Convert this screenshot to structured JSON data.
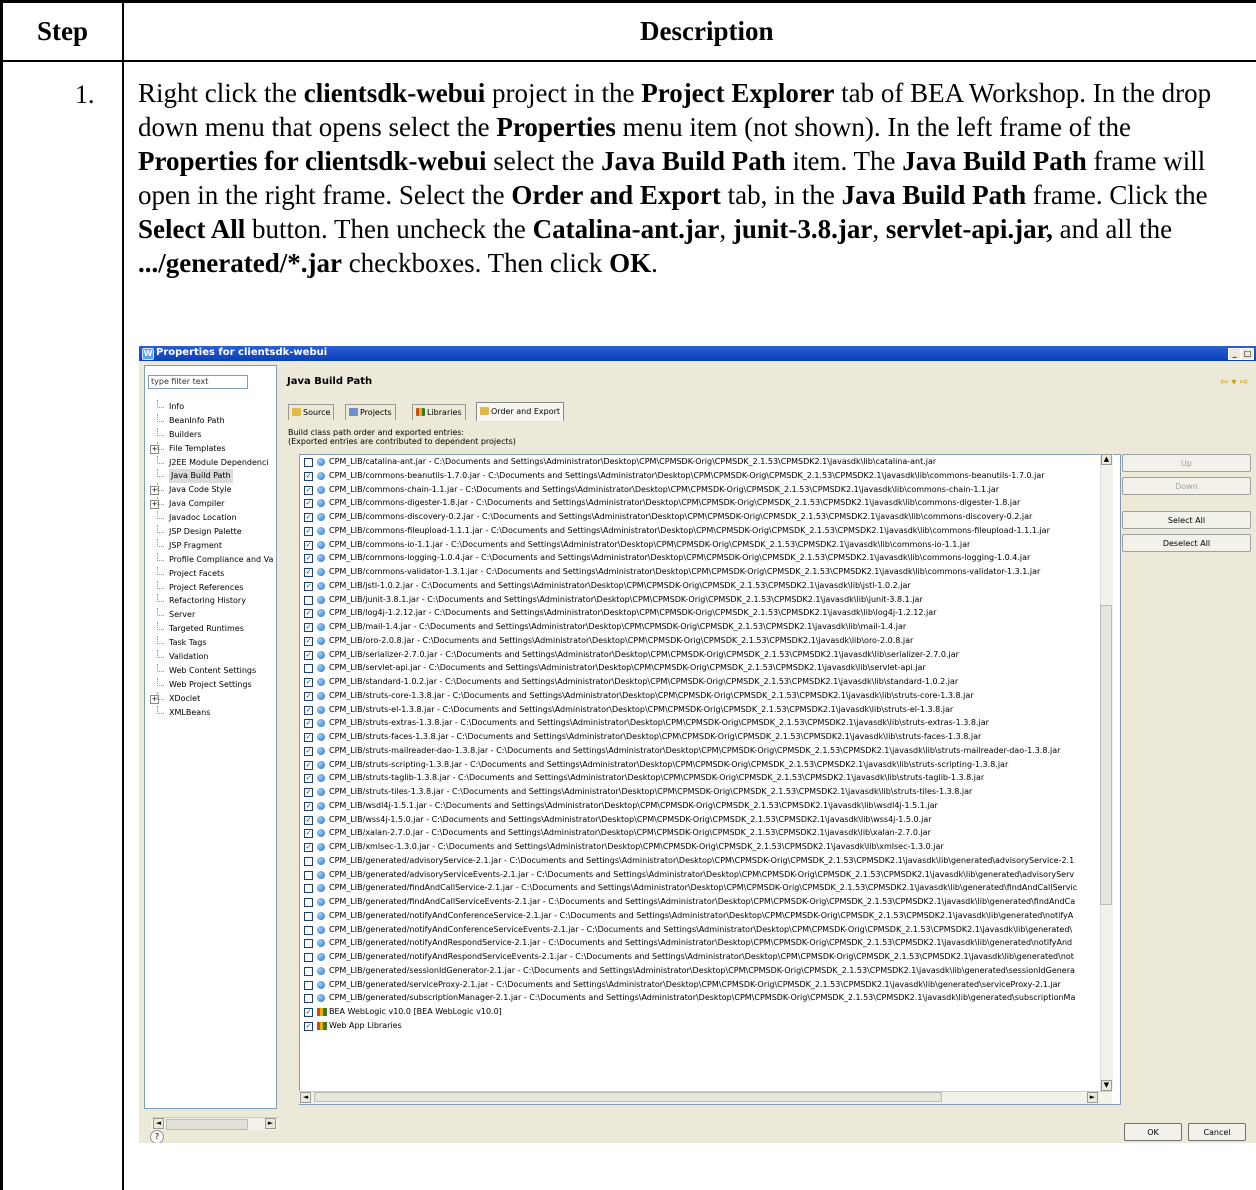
{
  "table": {
    "header_step": "Step",
    "header_description": "Description",
    "step_number": "1.",
    "instruction": [
      {
        "t": "Right click the ",
        "b": false
      },
      {
        "t": "clientsdk-webui",
        "b": true
      },
      {
        "t": " project in the ",
        "b": false
      },
      {
        "t": "Project Explorer",
        "b": true
      },
      {
        "t": " tab of BEA Workshop. In the drop down menu that opens select the ",
        "b": false
      },
      {
        "t": "Properties",
        "b": true
      },
      {
        "t": " menu item (not shown). In the left frame of the ",
        "b": false
      },
      {
        "t": "Properties for clientsdk-webui",
        "b": true
      },
      {
        "t": " select the ",
        "b": false
      },
      {
        "t": "Java Build Path",
        "b": true
      },
      {
        "t": " item. The ",
        "b": false
      },
      {
        "t": "Java Build Path",
        "b": true
      },
      {
        "t": " frame will open in the right frame. Select the ",
        "b": false
      },
      {
        "t": "Order and Export",
        "b": true
      },
      {
        "t": " tab, in the ",
        "b": false
      },
      {
        "t": "Java Build Path",
        "b": true
      },
      {
        "t": " frame. Click the ",
        "b": false
      },
      {
        "t": "Select All",
        "b": true
      },
      {
        "t": " button. Then uncheck the ",
        "b": false
      },
      {
        "t": "Catalina-ant.jar",
        "b": true
      },
      {
        "t": ", ",
        "b": false
      },
      {
        "t": "junit-3.8.jar",
        "b": true
      },
      {
        "t": ", ",
        "b": false
      },
      {
        "t": "servlet-api.jar,",
        "b": true
      },
      {
        "t": " and all the ",
        "b": false
      },
      {
        "t": ".../generated/*.jar",
        "b": true
      },
      {
        "t": " checkboxes. Then click ",
        "b": false
      },
      {
        "t": "OK",
        "b": true
      },
      {
        "t": ".",
        "b": false
      }
    ]
  },
  "dialog": {
    "title": "Properties for clientsdk-webui",
    "filter_placeholder": "type filter text",
    "tree": [
      {
        "label": "Info",
        "exp": false,
        "sel": false
      },
      {
        "label": "BeanInfo Path",
        "exp": false,
        "sel": false
      },
      {
        "label": "Builders",
        "exp": false,
        "sel": false
      },
      {
        "label": "File Templates",
        "exp": true,
        "sel": false
      },
      {
        "label": "J2EE Module Dependenci",
        "exp": false,
        "sel": false
      },
      {
        "label": "Java Build Path",
        "exp": false,
        "sel": true
      },
      {
        "label": "Java Code Style",
        "exp": true,
        "sel": false
      },
      {
        "label": "Java Compiler",
        "exp": true,
        "sel": false
      },
      {
        "label": "Javadoc Location",
        "exp": false,
        "sel": false
      },
      {
        "label": "JSP Design Palette",
        "exp": false,
        "sel": false
      },
      {
        "label": "JSP Fragment",
        "exp": false,
        "sel": false
      },
      {
        "label": "Profile Compliance and Va",
        "exp": false,
        "sel": false
      },
      {
        "label": "Project Facets",
        "exp": false,
        "sel": false
      },
      {
        "label": "Project References",
        "exp": false,
        "sel": false
      },
      {
        "label": "Refactoring History",
        "exp": false,
        "sel": false
      },
      {
        "label": "Server",
        "exp": false,
        "sel": false
      },
      {
        "label": "Targeted Runtimes",
        "exp": false,
        "sel": false
      },
      {
        "label": "Task Tags",
        "exp": false,
        "sel": false
      },
      {
        "label": "Validation",
        "exp": false,
        "sel": false
      },
      {
        "label": "Web Content Settings",
        "exp": false,
        "sel": false
      },
      {
        "label": "Web Project Settings",
        "exp": false,
        "sel": false
      },
      {
        "label": "XDoclet",
        "exp": true,
        "sel": false
      },
      {
        "label": "XMLBeans",
        "exp": false,
        "sel": false
      }
    ],
    "page_title": "Java Build Path",
    "tabs": [
      "Source",
      "Projects",
      "Libraries",
      "Order and Export"
    ],
    "active_tab": "Order and Export",
    "desc_line1": "Build class path order and exported entries:",
    "desc_line2": "(Exported entries are contributed to dependent projects)",
    "entries": [
      {
        "text": "CPM_LIB/catalina-ant.jar - C:\\Documents and Settings\\Administrator\\Desktop\\CPM\\CPMSDK-Orig\\CPMSDK_2.1.53\\CPMSDK2.1\\javasdk\\lib\\catalina-ant.jar",
        "checked": false,
        "kind": "jar"
      },
      {
        "text": "CPM_LIB/commons-beanutils-1.7.0.jar - C:\\Documents and Settings\\Administrator\\Desktop\\CPM\\CPMSDK-Orig\\CPMSDK_2.1.53\\CPMSDK2.1\\javasdk\\lib\\commons-beanutils-1.7.0.jar",
        "checked": true,
        "kind": "jar"
      },
      {
        "text": "CPM_LIB/commons-chain-1.1.jar - C:\\Documents and Settings\\Administrator\\Desktop\\CPM\\CPMSDK-Orig\\CPMSDK_2.1.53\\CPMSDK2.1\\javasdk\\lib\\commons-chain-1.1.jar",
        "checked": true,
        "kind": "jar"
      },
      {
        "text": "CPM_LIB/commons-digester-1.8.jar - C:\\Documents and Settings\\Administrator\\Desktop\\CPM\\CPMSDK-Orig\\CPMSDK_2.1.53\\CPMSDK2.1\\javasdk\\lib\\commons-digester-1.8.jar",
        "checked": true,
        "kind": "jar"
      },
      {
        "text": "CPM_LIB/commons-discovery-0.2.jar - C:\\Documents and Settings\\Administrator\\Desktop\\CPM\\CPMSDK-Orig\\CPMSDK_2.1.53\\CPMSDK2.1\\javasdk\\lib\\commons-discovery-0.2.jar",
        "checked": true,
        "kind": "jar"
      },
      {
        "text": "CPM_LIB/commons-fileupload-1.1.1.jar - C:\\Documents and Settings\\Administrator\\Desktop\\CPM\\CPMSDK-Orig\\CPMSDK_2.1.53\\CPMSDK2.1\\javasdk\\lib\\commons-fileupload-1.1.1.jar",
        "checked": true,
        "kind": "jar"
      },
      {
        "text": "CPM_LIB/commons-io-1.1.jar - C:\\Documents and Settings\\Administrator\\Desktop\\CPM\\CPMSDK-Orig\\CPMSDK_2.1.53\\CPMSDK2.1\\javasdk\\lib\\commons-io-1.1.jar",
        "checked": true,
        "kind": "jar"
      },
      {
        "text": "CPM_LIB/commons-logging-1.0.4.jar - C:\\Documents and Settings\\Administrator\\Desktop\\CPM\\CPMSDK-Orig\\CPMSDK_2.1.53\\CPMSDK2.1\\javasdk\\lib\\commons-logging-1.0.4.jar",
        "checked": true,
        "kind": "jar"
      },
      {
        "text": "CPM_LIB/commons-validator-1.3.1.jar - C:\\Documents and Settings\\Administrator\\Desktop\\CPM\\CPMSDK-Orig\\CPMSDK_2.1.53\\CPMSDK2.1\\javasdk\\lib\\commons-validator-1.3.1.jar",
        "checked": true,
        "kind": "jar"
      },
      {
        "text": "CPM_LIB/jstl-1.0.2.jar - C:\\Documents and Settings\\Administrator\\Desktop\\CPM\\CPMSDK-Orig\\CPMSDK_2.1.53\\CPMSDK2.1\\javasdk\\lib\\jstl-1.0.2.jar",
        "checked": true,
        "kind": "jar"
      },
      {
        "text": "CPM_LIB/junit-3.8.1.jar - C:\\Documents and Settings\\Administrator\\Desktop\\CPM\\CPMSDK-Orig\\CPMSDK_2.1.53\\CPMSDK2.1\\javasdk\\lib\\junit-3.8.1.jar",
        "checked": false,
        "kind": "jar"
      },
      {
        "text": "CPM_LIB/log4j-1.2.12.jar - C:\\Documents and Settings\\Administrator\\Desktop\\CPM\\CPMSDK-Orig\\CPMSDK_2.1.53\\CPMSDK2.1\\javasdk\\lib\\log4j-1.2.12.jar",
        "checked": true,
        "kind": "jar"
      },
      {
        "text": "CPM_LIB/mail-1.4.jar - C:\\Documents and Settings\\Administrator\\Desktop\\CPM\\CPMSDK-Orig\\CPMSDK_2.1.53\\CPMSDK2.1\\javasdk\\lib\\mail-1.4.jar",
        "checked": true,
        "kind": "jar"
      },
      {
        "text": "CPM_LIB/oro-2.0.8.jar - C:\\Documents and Settings\\Administrator\\Desktop\\CPM\\CPMSDK-Orig\\CPMSDK_2.1.53\\CPMSDK2.1\\javasdk\\lib\\oro-2.0.8.jar",
        "checked": true,
        "kind": "jar"
      },
      {
        "text": "CPM_LIB/serializer-2.7.0.jar - C:\\Documents and Settings\\Administrator\\Desktop\\CPM\\CPMSDK-Orig\\CPMSDK_2.1.53\\CPMSDK2.1\\javasdk\\lib\\serializer-2.7.0.jar",
        "checked": true,
        "kind": "jar"
      },
      {
        "text": "CPM_LIB/servlet-api.jar - C:\\Documents and Settings\\Administrator\\Desktop\\CPM\\CPMSDK-Orig\\CPMSDK_2.1.53\\CPMSDK2.1\\javasdk\\lib\\servlet-api.jar",
        "checked": false,
        "kind": "jar"
      },
      {
        "text": "CPM_LIB/standard-1.0.2.jar - C:\\Documents and Settings\\Administrator\\Desktop\\CPM\\CPMSDK-Orig\\CPMSDK_2.1.53\\CPMSDK2.1\\javasdk\\lib\\standard-1.0.2.jar",
        "checked": true,
        "kind": "jar"
      },
      {
        "text": "CPM_LIB/struts-core-1.3.8.jar - C:\\Documents and Settings\\Administrator\\Desktop\\CPM\\CPMSDK-Orig\\CPMSDK_2.1.53\\CPMSDK2.1\\javasdk\\lib\\struts-core-1.3.8.jar",
        "checked": true,
        "kind": "jar"
      },
      {
        "text": "CPM_LIB/struts-el-1.3.8.jar - C:\\Documents and Settings\\Administrator\\Desktop\\CPM\\CPMSDK-Orig\\CPMSDK_2.1.53\\CPMSDK2.1\\javasdk\\lib\\struts-el-1.3.8.jar",
        "checked": true,
        "kind": "jar"
      },
      {
        "text": "CPM_LIB/struts-extras-1.3.8.jar - C:\\Documents and Settings\\Administrator\\Desktop\\CPM\\CPMSDK-Orig\\CPMSDK_2.1.53\\CPMSDK2.1\\javasdk\\lib\\struts-extras-1.3.8.jar",
        "checked": true,
        "kind": "jar"
      },
      {
        "text": "CPM_LIB/struts-faces-1.3.8.jar - C:\\Documents and Settings\\Administrator\\Desktop\\CPM\\CPMSDK-Orig\\CPMSDK_2.1.53\\CPMSDK2.1\\javasdk\\lib\\struts-faces-1.3.8.jar",
        "checked": true,
        "kind": "jar"
      },
      {
        "text": "CPM_LIB/struts-mailreader-dao-1.3.8.jar - C:\\Documents and Settings\\Administrator\\Desktop\\CPM\\CPMSDK-Orig\\CPMSDK_2.1.53\\CPMSDK2.1\\javasdk\\lib\\struts-mailreader-dao-1.3.8.jar",
        "checked": true,
        "kind": "jar"
      },
      {
        "text": "CPM_LIB/struts-scripting-1.3.8.jar - C:\\Documents and Settings\\Administrator\\Desktop\\CPM\\CPMSDK-Orig\\CPMSDK_2.1.53\\CPMSDK2.1\\javasdk\\lib\\struts-scripting-1.3.8.jar",
        "checked": true,
        "kind": "jar"
      },
      {
        "text": "CPM_LIB/struts-taglib-1.3.8.jar - C:\\Documents and Settings\\Administrator\\Desktop\\CPM\\CPMSDK-Orig\\CPMSDK_2.1.53\\CPMSDK2.1\\javasdk\\lib\\struts-taglib-1.3.8.jar",
        "checked": true,
        "kind": "jar"
      },
      {
        "text": "CPM_LIB/struts-tiles-1.3.8.jar - C:\\Documents and Settings\\Administrator\\Desktop\\CPM\\CPMSDK-Orig\\CPMSDK_2.1.53\\CPMSDK2.1\\javasdk\\lib\\struts-tiles-1.3.8.jar",
        "checked": true,
        "kind": "jar"
      },
      {
        "text": "CPM_LIB/wsdl4j-1.5.1.jar - C:\\Documents and Settings\\Administrator\\Desktop\\CPM\\CPMSDK-Orig\\CPMSDK_2.1.53\\CPMSDK2.1\\javasdk\\lib\\wsdl4j-1.5.1.jar",
        "checked": true,
        "kind": "jar"
      },
      {
        "text": "CPM_LIB/wss4j-1.5.0.jar - C:\\Documents and Settings\\Administrator\\Desktop\\CPM\\CPMSDK-Orig\\CPMSDK_2.1.53\\CPMSDK2.1\\javasdk\\lib\\wss4j-1.5.0.jar",
        "checked": true,
        "kind": "jar"
      },
      {
        "text": "CPM_LIB/xalan-2.7.0.jar - C:\\Documents and Settings\\Administrator\\Desktop\\CPM\\CPMSDK-Orig\\CPMSDK_2.1.53\\CPMSDK2.1\\javasdk\\lib\\xalan-2.7.0.jar",
        "checked": true,
        "kind": "jar"
      },
      {
        "text": "CPM_LIB/xmlsec-1.3.0.jar - C:\\Documents and Settings\\Administrator\\Desktop\\CPM\\CPMSDK-Orig\\CPMSDK_2.1.53\\CPMSDK2.1\\javasdk\\lib\\xmlsec-1.3.0.jar",
        "checked": true,
        "kind": "jar"
      },
      {
        "text": "CPM_LIB/generated/advisoryService-2.1.jar - C:\\Documents and Settings\\Administrator\\Desktop\\CPM\\CPMSDK-Orig\\CPMSDK_2.1.53\\CPMSDK2.1\\javasdk\\lib\\generated\\advisoryService-2.1",
        "checked": false,
        "kind": "jar"
      },
      {
        "text": "CPM_LIB/generated/advisoryServiceEvents-2.1.jar - C:\\Documents and Settings\\Administrator\\Desktop\\CPM\\CPMSDK-Orig\\CPMSDK_2.1.53\\CPMSDK2.1\\javasdk\\lib\\generated\\advisoryServ",
        "checked": false,
        "kind": "jar"
      },
      {
        "text": "CPM_LIB/generated/findAndCallService-2.1.jar - C:\\Documents and Settings\\Administrator\\Desktop\\CPM\\CPMSDK-Orig\\CPMSDK_2.1.53\\CPMSDK2.1\\javasdk\\lib\\generated\\findAndCallServic",
        "checked": false,
        "kind": "jar"
      },
      {
        "text": "CPM_LIB/generated/findAndCallServiceEvents-2.1.jar - C:\\Documents and Settings\\Administrator\\Desktop\\CPM\\CPMSDK-Orig\\CPMSDK_2.1.53\\CPMSDK2.1\\javasdk\\lib\\generated\\findAndCa",
        "checked": false,
        "kind": "jar"
      },
      {
        "text": "CPM_LIB/generated/notifyAndConferenceService-2.1.jar - C:\\Documents and Settings\\Administrator\\Desktop\\CPM\\CPMSDK-Orig\\CPMSDK_2.1.53\\CPMSDK2.1\\javasdk\\lib\\generated\\notifyA",
        "checked": false,
        "kind": "jar"
      },
      {
        "text": "CPM_LIB/generated/notifyAndConferenceServiceEvents-2.1.jar - C:\\Documents and Settings\\Administrator\\Desktop\\CPM\\CPMSDK-Orig\\CPMSDK_2.1.53\\CPMSDK2.1\\javasdk\\lib\\generated\\",
        "checked": false,
        "kind": "jar"
      },
      {
        "text": "CPM_LIB/generated/notifyAndRespondService-2.1.jar - C:\\Documents and Settings\\Administrator\\Desktop\\CPM\\CPMSDK-Orig\\CPMSDK_2.1.53\\CPMSDK2.1\\javasdk\\lib\\generated\\notifyAnd",
        "checked": false,
        "kind": "jar"
      },
      {
        "text": "CPM_LIB/generated/notifyAndRespondServiceEvents-2.1.jar - C:\\Documents and Settings\\Administrator\\Desktop\\CPM\\CPMSDK-Orig\\CPMSDK_2.1.53\\CPMSDK2.1\\javasdk\\lib\\generated\\not",
        "checked": false,
        "kind": "jar"
      },
      {
        "text": "CPM_LIB/generated/sessionIdGenerator-2.1.jar - C:\\Documents and Settings\\Administrator\\Desktop\\CPM\\CPMSDK-Orig\\CPMSDK_2.1.53\\CPMSDK2.1\\javasdk\\lib\\generated\\sessionIdGenera",
        "checked": false,
        "kind": "jar"
      },
      {
        "text": "CPM_LIB/generated/serviceProxy-2.1.jar - C:\\Documents and Settings\\Administrator\\Desktop\\CPM\\CPMSDK-Orig\\CPMSDK_2.1.53\\CPMSDK2.1\\javasdk\\lib\\generated\\serviceProxy-2.1.jar",
        "checked": false,
        "kind": "jar"
      },
      {
        "text": "CPM_LIB/generated/subscriptionManager-2.1.jar - C:\\Documents and Settings\\Administrator\\Desktop\\CPM\\CPMSDK-Orig\\CPMSDK_2.1.53\\CPMSDK2.1\\javasdk\\lib\\generated\\subscriptionMa",
        "checked": false,
        "kind": "jar"
      },
      {
        "text": "BEA WebLogic v10.0 [BEA WebLogic v10.0]",
        "checked": true,
        "kind": "lib"
      },
      {
        "text": "Web App Libraries",
        "checked": true,
        "kind": "lib"
      }
    ],
    "buttons": {
      "up": "Up",
      "down": "Down",
      "select_all": "Select All",
      "deselect_all": "Deselect All",
      "ok": "OK",
      "cancel": "Cancel"
    },
    "colors": {
      "titlebar": "#0a3fb8",
      "dialog_bg": "#ece9d8",
      "list_border": "#7f9db9"
    }
  }
}
